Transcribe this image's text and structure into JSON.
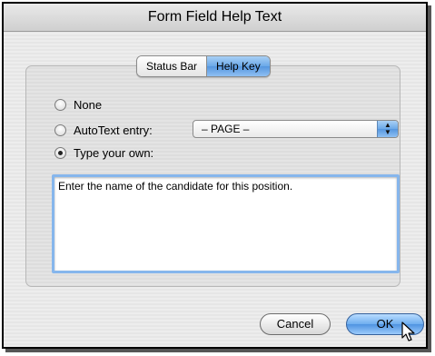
{
  "window": {
    "title": "Form Field Help Text"
  },
  "tabs": [
    {
      "label": "Status Bar",
      "active": false
    },
    {
      "label": "Help Key",
      "active": true
    }
  ],
  "options": {
    "none_label": "None",
    "autotext_label": "AutoText entry:",
    "type_own_label": "Type your own:",
    "selected": "type_own"
  },
  "autotext_select": {
    "value": "– PAGE –"
  },
  "help_text": {
    "value": "Enter the name of the candidate for this position."
  },
  "buttons": {
    "cancel": "Cancel",
    "ok": "OK"
  },
  "colors": {
    "accent": "#6aa8e8",
    "focus_ring": "#86b6ec"
  }
}
